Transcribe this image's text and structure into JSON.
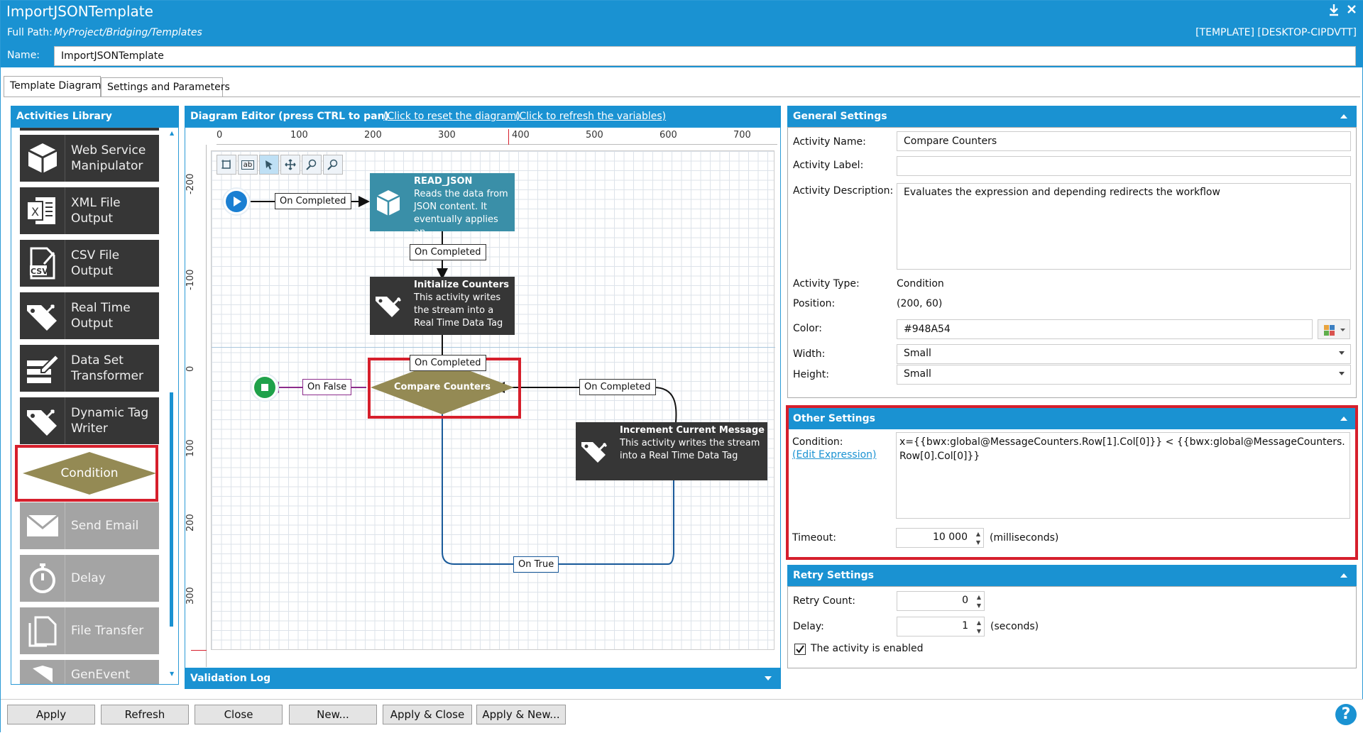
{
  "window": {
    "title": "ImportJSONTemplate"
  },
  "path": {
    "label": "Full Path:",
    "value": "MyProject/Bridging/Templates",
    "right": "[TEMPLATE] [DESKTOP-CIPDVTT]"
  },
  "name": {
    "label": "Name:",
    "value": "ImportJSONTemplate"
  },
  "tabs": [
    {
      "label": "Template Diagram",
      "selected": true
    },
    {
      "label": "Settings and Parameters",
      "selected": false
    }
  ],
  "library": {
    "title": "Activities Library",
    "items": [
      {
        "label": "Web Service Manipulator",
        "icon": "box-icon"
      },
      {
        "label": "XML File Output",
        "icon": "excel-file-icon"
      },
      {
        "label": "CSV File Output",
        "icon": "csv-file-icon"
      },
      {
        "label": "Real Time Output",
        "icon": "tag-icon"
      },
      {
        "label": "Data Set Transformer",
        "icon": "dataset-edit-icon"
      },
      {
        "label": "Dynamic Tag Writer",
        "icon": "tag-icon"
      },
      {
        "label": "Condition",
        "icon": "diamond-icon"
      },
      {
        "label": "Send Email",
        "icon": "envelope-icon"
      },
      {
        "label": "Delay",
        "icon": "stopwatch-icon"
      },
      {
        "label": "File Transfer",
        "icon": "files-icon"
      },
      {
        "label": "GenEvent",
        "icon": "shield-icon"
      }
    ]
  },
  "diagram": {
    "title": "Diagram Editor (press CTRL to pan)",
    "reset_link": "(Click to reset the diagram)",
    "refresh_link": "(Click to refresh the variables)",
    "ruler_x": [
      "0",
      "100",
      "200",
      "300",
      "400",
      "500",
      "600",
      "700"
    ],
    "ruler_y": [
      "-200",
      "-100",
      "0",
      "100",
      "200",
      "300"
    ],
    "toolbar": [
      "select-frame-icon",
      "text-label-icon",
      "pointer-icon",
      "move-icon",
      "zoom-in-icon",
      "zoom-out-icon"
    ],
    "nodes": {
      "read_json": {
        "title": "READ_JSON",
        "desc": "Reads the data from JSON content. It eventually applies an..."
      },
      "init": {
        "title": "Initialize Counters",
        "desc": "This activity writes the stream into a Real Time Data Tag"
      },
      "compare": {
        "title": "Compare Counters",
        "color": "#948A54"
      },
      "increment": {
        "title": "Increment Current Message",
        "desc": "This activity writes the stream into a Real Time Data Tag"
      }
    },
    "labels": {
      "completed": "On Completed",
      "on_false": "On False",
      "on_true": "On True"
    }
  },
  "validation": {
    "title": "Validation Log"
  },
  "general": {
    "title": "General Settings",
    "activity_name_label": "Activity Name:",
    "activity_name": "Compare Counters",
    "activity_label_label": "Activity Label:",
    "activity_label": "",
    "description_label": "Activity Description:",
    "description": "Evaluates the expression and depending redirects the workflow",
    "type_label": "Activity Type:",
    "type": "Condition",
    "position_label": "Position:",
    "position": "(200, 60)",
    "color_label": "Color:",
    "color": "#948A54",
    "width_label": "Width:",
    "width": "Small",
    "height_label": "Height:",
    "height": "Small"
  },
  "other": {
    "title": "Other Settings",
    "condition_label": "Condition:",
    "edit_link": "(Edit Expression)",
    "condition": "x={{bwx:global@MessageCounters.Row[1].Col[0]}} < {{bwx:global@MessageCounters.Row[0].Col[0]}}",
    "timeout_label": "Timeout:",
    "timeout": "10 000",
    "timeout_unit": "(milliseconds)"
  },
  "retry": {
    "title": "Retry Settings",
    "count_label": "Retry Count:",
    "count": "0",
    "delay_label": "Delay:",
    "delay": "1",
    "delay_unit": "(seconds)",
    "enabled_label": "The activity is enabled",
    "enabled": true
  },
  "buttons": {
    "apply": "Apply",
    "refresh": "Refresh",
    "close": "Close",
    "new": "New...",
    "apply_close": "Apply & Close",
    "apply_new": "Apply & New..."
  },
  "colors": {
    "accent": "#1A92D2",
    "dark_node": "#363636",
    "teal_node": "#3A8FA8",
    "highlight": "#D61F2C"
  }
}
